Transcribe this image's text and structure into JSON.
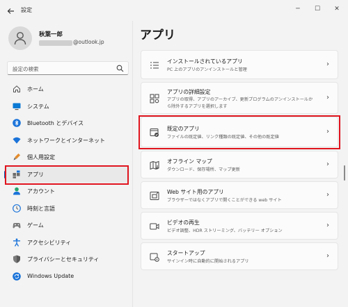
{
  "window": {
    "title": "設定",
    "minimize": "─",
    "maximize": "☐",
    "close": "✕"
  },
  "user": {
    "name": "秋葉一郎",
    "email_suffix": "@outlook.jp"
  },
  "search": {
    "placeholder": "設定の検索"
  },
  "nav": [
    {
      "label": "ホーム",
      "icon": "home-icon"
    },
    {
      "label": "システム",
      "icon": "system-icon"
    },
    {
      "label": "Bluetooth とデバイス",
      "icon": "bluetooth-icon"
    },
    {
      "label": "ネットワークとインターネット",
      "icon": "network-icon"
    },
    {
      "label": "個人用設定",
      "icon": "personalization-icon"
    },
    {
      "label": "アプリ",
      "icon": "apps-icon",
      "selected": true
    },
    {
      "label": "アカウント",
      "icon": "accounts-icon"
    },
    {
      "label": "時刻と言語",
      "icon": "time-language-icon"
    },
    {
      "label": "ゲーム",
      "icon": "gaming-icon"
    },
    {
      "label": "アクセシビリティ",
      "icon": "accessibility-icon"
    },
    {
      "label": "プライバシーとセキュリティ",
      "icon": "privacy-icon"
    },
    {
      "label": "Windows Update",
      "icon": "windows-update-icon"
    }
  ],
  "main": {
    "title": "アプリ",
    "cards": [
      {
        "title": "インストールされているアプリ",
        "subtitle": "PC 上のアプリのアンインストールと管理",
        "icon": "installed-apps-icon"
      },
      {
        "title": "アプリの詳細設定",
        "subtitle": "アプリの取得、アプリのアーカイブ、更新プログラムのアンインストールから除外するアプリを選択します",
        "icon": "advanced-apps-icon"
      },
      {
        "title": "既定のアプリ",
        "subtitle": "ファイルの既定値、リンク種類の既定値、その他の既定値",
        "icon": "default-apps-icon"
      },
      {
        "title": "オフライン マップ",
        "subtitle": "ダウンロード、保存場所、マップ更新",
        "icon": "offline-maps-icon"
      },
      {
        "title": "Web サイト用のアプリ",
        "subtitle": "ブラウザーではなくアプリで開くことができる web サイト",
        "icon": "web-apps-icon"
      },
      {
        "title": "ビデオの再生",
        "subtitle": "ビデオ調整、HDR ストリーミング、バッテリー オプション",
        "icon": "video-playback-icon"
      },
      {
        "title": "スタートアップ",
        "subtitle": "サインイン時に自動的に開始されるアプリ",
        "icon": "startup-icon"
      }
    ]
  },
  "colors": {
    "accent": "#005fb8",
    "highlight": "#e0141e",
    "background": "#f3f3f3",
    "card": "#fbfbfb"
  }
}
